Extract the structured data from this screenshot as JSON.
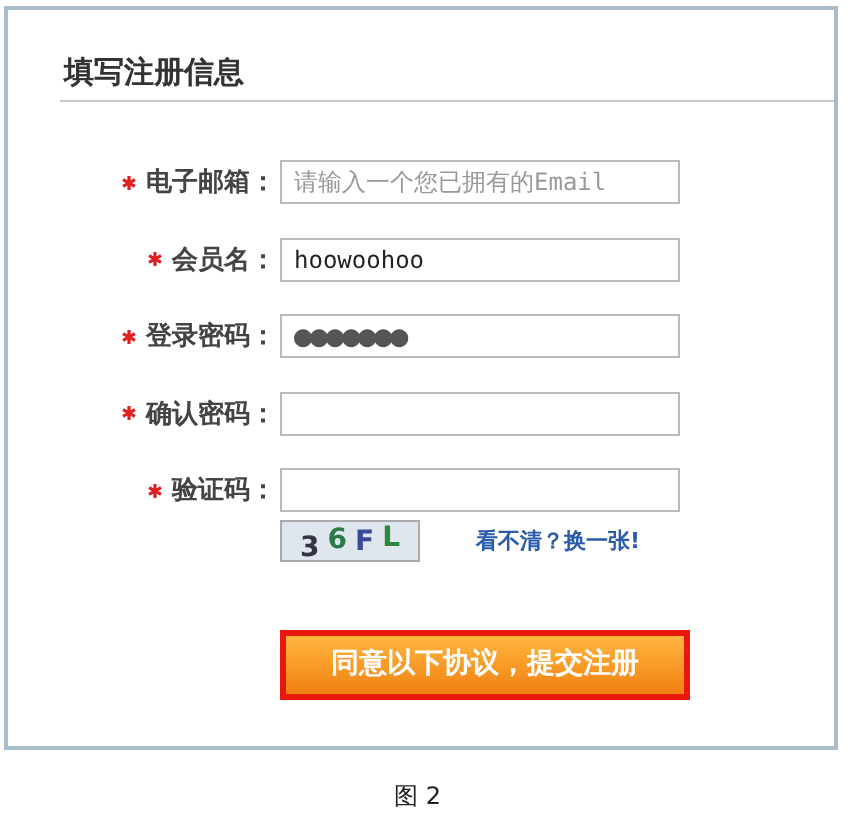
{
  "title": "填写注册信息",
  "fields": [
    {
      "label": "电子邮箱：",
      "required": true,
      "placeholder": "请输入一个您已拥有的Email"
    },
    {
      "label": "会员名：",
      "required": true,
      "value": "hoowoohoo"
    },
    {
      "label": "登录密码：",
      "required": true,
      "value": "●●●●●●●",
      "kind": "password"
    },
    {
      "label": "确认密码：",
      "required": true
    },
    {
      "label": "验证码：",
      "required": true
    }
  ],
  "captcha": {
    "text": "36FL",
    "refresh_link": "看不清？换一张!"
  },
  "submit_button": "同意以下协议，提交注册",
  "caption": "图 2"
}
